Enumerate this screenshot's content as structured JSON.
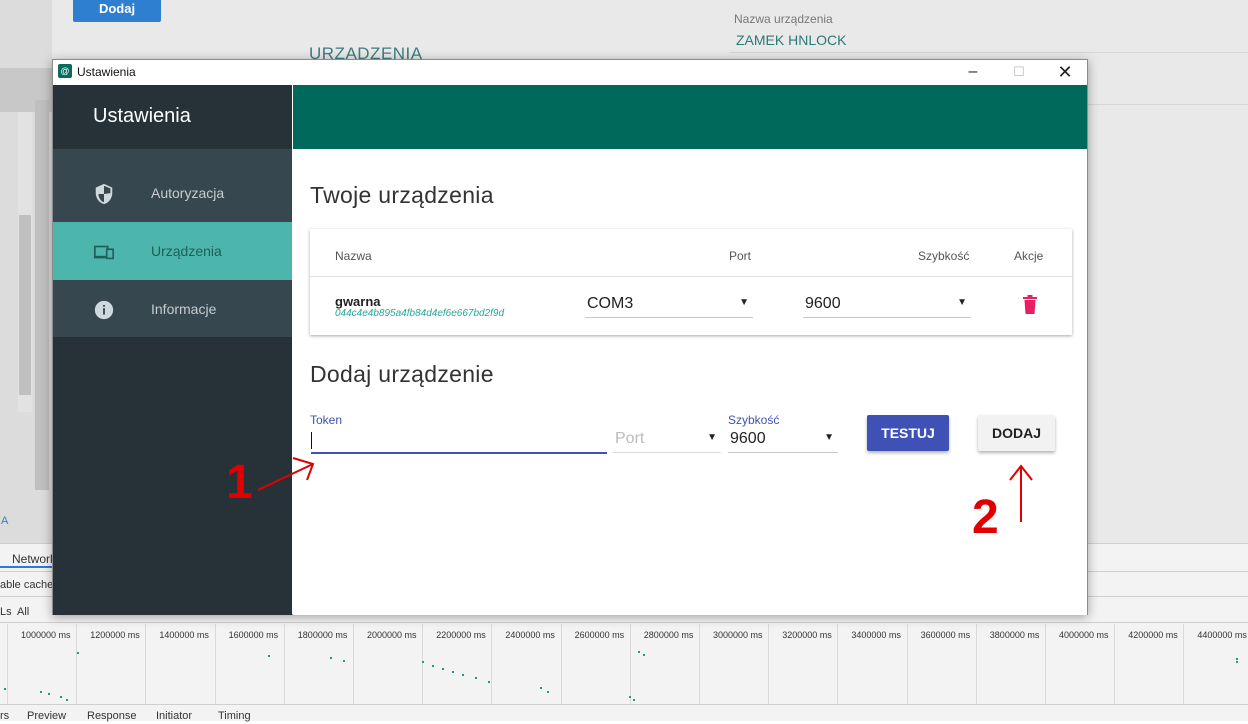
{
  "background": {
    "add_button": "Dodaj",
    "section_title": "URZADZENIA",
    "device_name_label": "Nazwa urządzenia",
    "device_name_value": "ZAMEK HNLOCK",
    "left_link": "A"
  },
  "devtools": {
    "network_tab": "Network",
    "disable_cache": "able cache",
    "filter_ls": "Ls",
    "filter_all": "All",
    "timeline_ticks": [
      "1000000 ms",
      "1200000 ms",
      "1400000 ms",
      "1600000 ms",
      "1800000 ms",
      "2000000 ms",
      "2200000 ms",
      "2400000 ms",
      "2600000 ms",
      "2800000 ms",
      "3000000 ms",
      "3200000 ms",
      "3400000 ms",
      "3600000 ms",
      "3800000 ms",
      "4000000 ms",
      "4200000 ms",
      "4400000 ms"
    ],
    "bottom_tabs": [
      "rs",
      "Preview",
      "Response",
      "Initiator",
      "Timing"
    ]
  },
  "window": {
    "title": "Ustawienia",
    "sidebar_title": "Ustawienia",
    "menu": [
      {
        "label": "Autoryzacja",
        "icon": "shield-icon"
      },
      {
        "label": "Urządzenia",
        "icon": "devices-icon"
      },
      {
        "label": "Informacje",
        "icon": "info-icon"
      }
    ],
    "devices_title": "Twoje urządzenia",
    "table": {
      "headers": {
        "name": "Nazwa",
        "port": "Port",
        "speed": "Szybkość",
        "actions": "Akcje"
      },
      "rows": [
        {
          "name": "gwarna",
          "id": "044c4e4b895a4fb84d4ef6e667bd2f9d",
          "port": "COM3",
          "speed": "9600"
        }
      ]
    },
    "add_title": "Dodaj urządzenie",
    "form": {
      "token_label": "Token",
      "token_value": "",
      "port_placeholder": "Port",
      "speed_label": "Szybkość",
      "speed_value": "9600",
      "test_button": "TESTUJ",
      "add_button": "DODAJ"
    }
  },
  "annotations": {
    "one": "1",
    "two": "2"
  },
  "colors": {
    "sidebar": "#263238",
    "header": "#00695c",
    "active": "#4db6ac",
    "primary": "#3f51b5",
    "accent_red": "#e00000"
  }
}
